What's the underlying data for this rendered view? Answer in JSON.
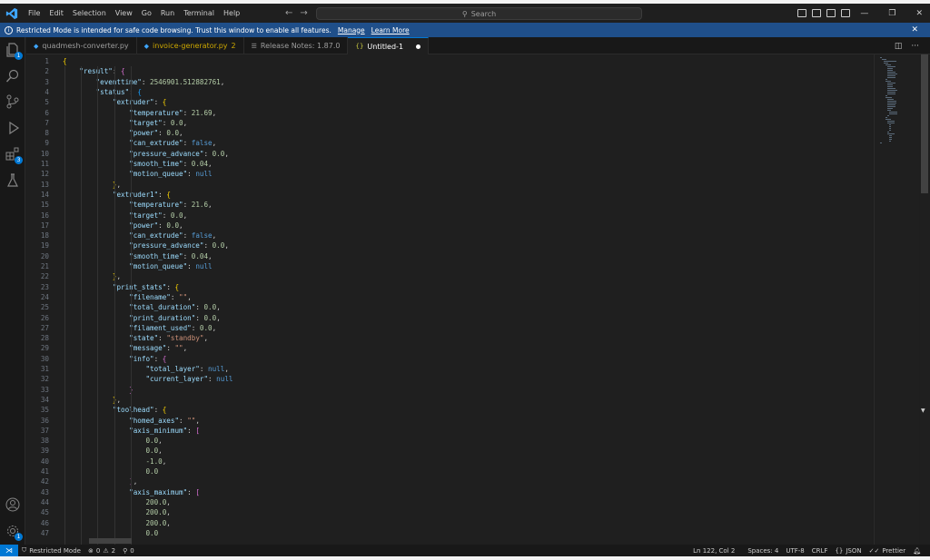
{
  "menu": [
    "File",
    "Edit",
    "Selection",
    "View",
    "Go",
    "Run",
    "Terminal",
    "Help"
  ],
  "search": {
    "label": "Search"
  },
  "banner": {
    "text": "Restricted Mode is intended for safe code browsing. Trust this window to enable all features.",
    "manage": "Manage",
    "learn_more": "Learn More"
  },
  "activity": {
    "explorer_badge": "1",
    "extensions_badge": "3",
    "accounts_badge": "1"
  },
  "tabs": [
    {
      "label": "quadmesh-converter.py",
      "problems": ""
    },
    {
      "label": "invoice-generator.py",
      "problems": "2"
    },
    {
      "label": "Release Notes: 1.87.0",
      "problems": ""
    },
    {
      "label": "Untitled-1",
      "problems": ""
    }
  ],
  "code_lines": [
    "{",
    "    \"result\": {",
    "        \"eventtime\": 2546901.512882761,",
    "        \"status\": {",
    "            \"extruder\": {",
    "                \"temperature\": 21.69,",
    "                \"target\": 0.0,",
    "                \"power\": 0.0,",
    "                \"can_extrude\": false,",
    "                \"pressure_advance\": 0.0,",
    "                \"smooth_time\": 0.04,",
    "                \"motion_queue\": null",
    "            },",
    "            \"extruder1\": {",
    "                \"temperature\": 21.6,",
    "                \"target\": 0.0,",
    "                \"power\": 0.0,",
    "                \"can_extrude\": false,",
    "                \"pressure_advance\": 0.0,",
    "                \"smooth_time\": 0.04,",
    "                \"motion_queue\": null",
    "            },",
    "            \"print_stats\": {",
    "                \"filename\": \"\",",
    "                \"total_duration\": 0.0,",
    "                \"print_duration\": 0.0,",
    "                \"filament_used\": 0.0,",
    "                \"state\": \"standby\",",
    "                \"message\": \"\",",
    "                \"info\": {",
    "                    \"total_layer\": null,",
    "                    \"current_layer\": null",
    "                }",
    "            },",
    "            \"toolhead\": {",
    "                \"homed_axes\": \"\",",
    "                \"axis_minimum\": [",
    "                    0.0,",
    "                    0.0,",
    "                    -1.0,",
    "                    0.0",
    "                ],",
    "                \"axis_maximum\": [",
    "                    200.0,",
    "                    200.0,",
    "                    200.0,",
    "                    0.0"
  ],
  "status": {
    "restricted": "Restricted Mode",
    "errors": "0",
    "warnings": "2",
    "ports": "0",
    "position": "Ln 122, Col 2",
    "spaces": "Spaces: 4",
    "encoding": "UTF-8",
    "eol": "CRLF",
    "language": "JSON",
    "prettier": "Prettier"
  }
}
